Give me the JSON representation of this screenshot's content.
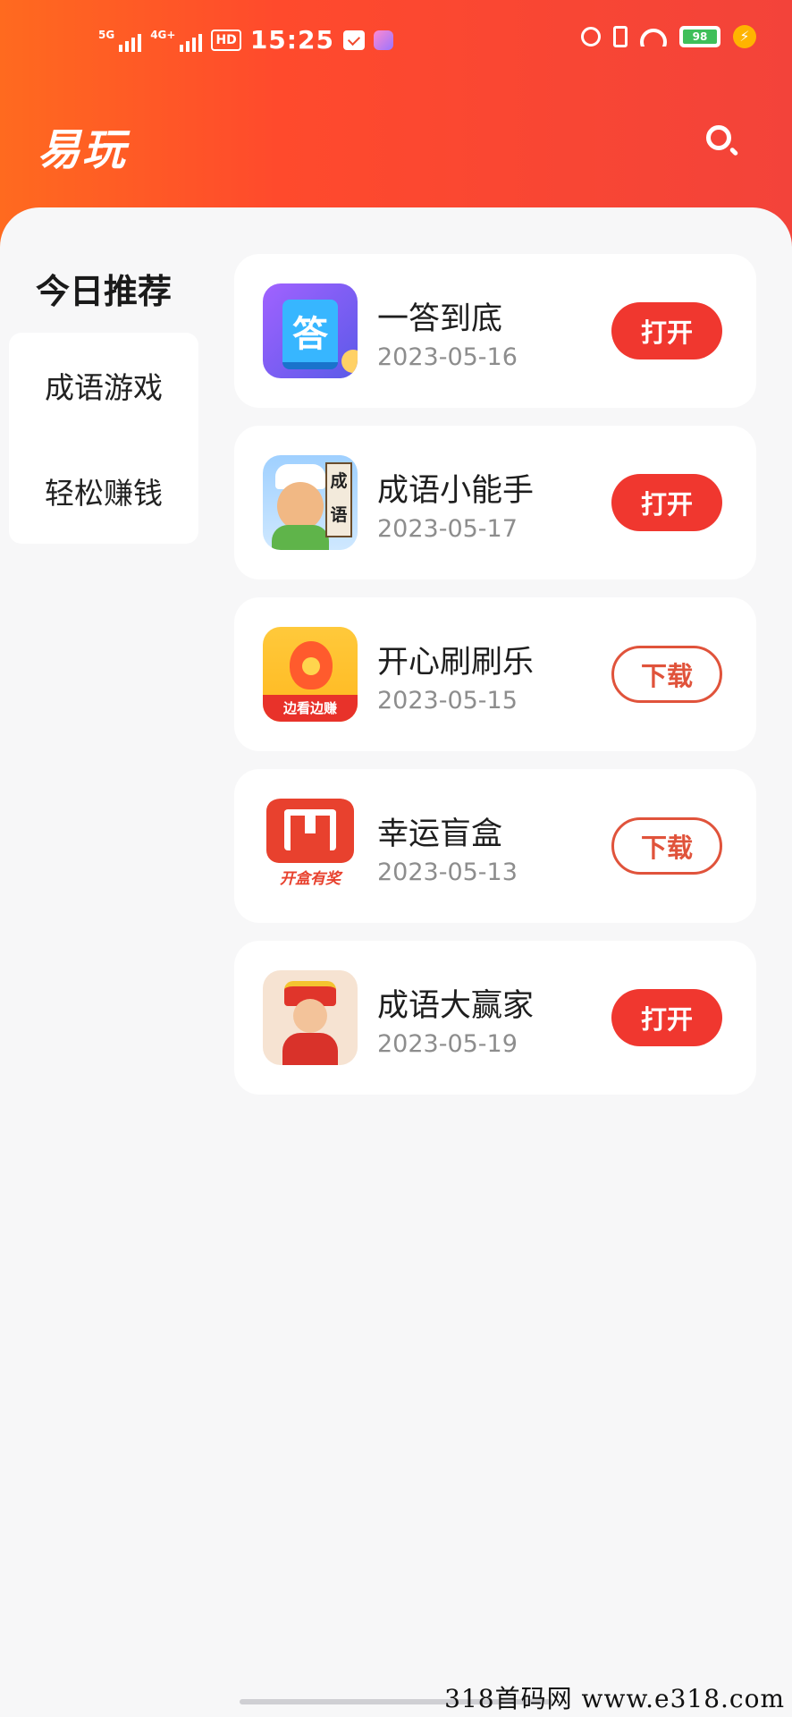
{
  "status_bar": {
    "signal1": "5G",
    "signal2": "4G+",
    "hd": "HD",
    "time": "15:25",
    "battery": "98",
    "icons": [
      "message-icon",
      "app-icon",
      "alarm-icon",
      "vibrate-icon",
      "wifi-icon",
      "battery-icon",
      "charging-icon"
    ]
  },
  "header": {
    "title": "易玩",
    "search_icon": "search-icon"
  },
  "sidebar": {
    "heading": "今日推荐",
    "items": [
      {
        "label": "成语游戏"
      },
      {
        "label": "轻松赚钱"
      }
    ]
  },
  "apps": [
    {
      "name": "一答到底",
      "date": "2023-05-16",
      "action": "打开",
      "action_type": "open",
      "icon_label": "答"
    },
    {
      "name": "成语小能手",
      "date": "2023-05-17",
      "action": "打开",
      "action_type": "open",
      "icon_label": "成语"
    },
    {
      "name": "开心刷刷乐",
      "date": "2023-05-15",
      "action": "下载",
      "action_type": "download",
      "icon_label": "边看边赚"
    },
    {
      "name": "幸运盲盒",
      "date": "2023-05-13",
      "action": "下载",
      "action_type": "download",
      "icon_label": "开盒有奖"
    },
    {
      "name": "成语大赢家",
      "date": "2023-05-19",
      "action": "打开",
      "action_type": "open",
      "icon_label": ""
    }
  ],
  "watermark": "318首码网  www.e318.com",
  "colors": {
    "header_start": "#ff6a1f",
    "header_end": "#f3433a",
    "open_button": "#f0372f",
    "download_border": "#e0533b",
    "background": "#f7f7f8"
  }
}
